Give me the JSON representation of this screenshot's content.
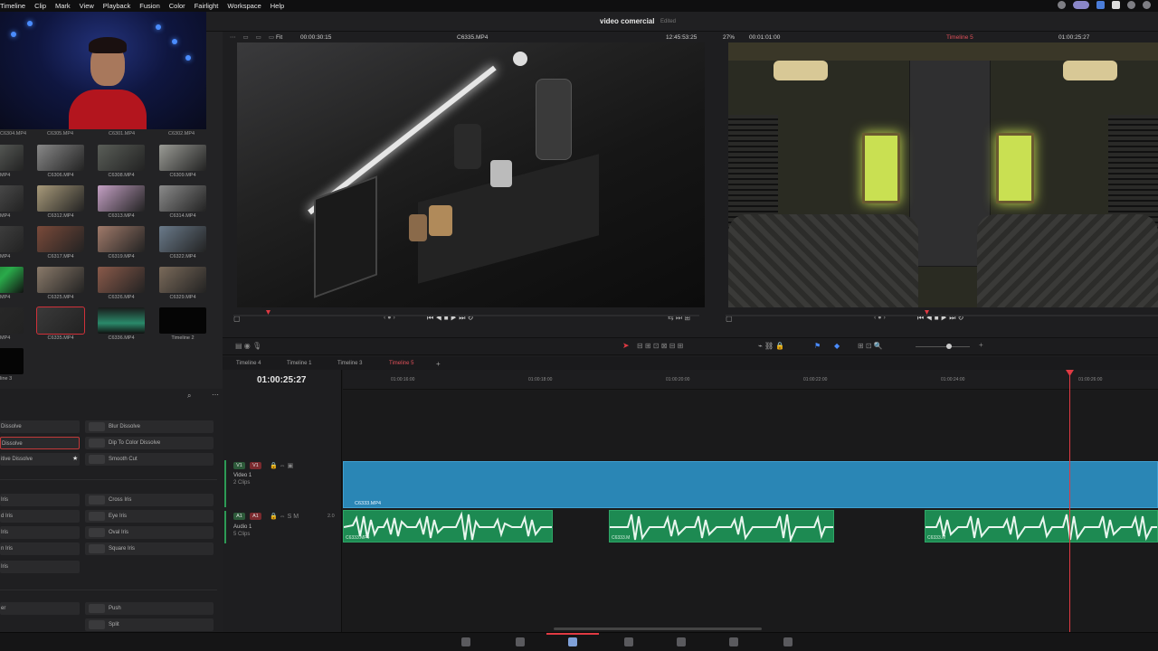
{
  "menu": {
    "items": [
      "Timeline",
      "Clip",
      "Mark",
      "View",
      "Playback",
      "Fusion",
      "Color",
      "Fairlight",
      "Workspace",
      "Help"
    ]
  },
  "project": {
    "title": "video comercial",
    "status": "Edited"
  },
  "media_pool": {
    "top_labels": [
      "C6304.MP4",
      "C6305.MP4",
      "C6301.MP4",
      "C6302.MP4"
    ],
    "rows": [
      {
        "labels": [
          "",
          "C6306.MP4",
          "C6308.MP4",
          "C6309.MP4"
        ],
        "left": "MP4"
      },
      {
        "labels": [
          "",
          "C6312.MP4",
          "C6313.MP4",
          "C6314.MP4"
        ],
        "left": "MP4"
      },
      {
        "labels": [
          "",
          "C6317.MP4",
          "C6319.MP4",
          "C6322.MP4"
        ],
        "left": "MP4"
      },
      {
        "labels": [
          "",
          "C6325.MP4",
          "C6326.MP4",
          "C6329.MP4"
        ],
        "left": "MP4"
      },
      {
        "labels": [
          "",
          "C6335.MP4",
          "C6336.MP4",
          "Timeline 2"
        ],
        "left": "MP4"
      }
    ],
    "last_label": "line 3",
    "selected": "C6335.MP4"
  },
  "effects": {
    "rows": [
      {
        "left": "Dissolve",
        "right": "Blur Dissolve"
      },
      {
        "left": "Dissolve",
        "right": "Dip To Color Dissolve",
        "selected": true
      },
      {
        "left": "itive Dissolve",
        "right": "Smooth Cut"
      },
      {
        "left": "Iris",
        "right": "Cross Iris"
      },
      {
        "left": "d Iris",
        "right": "Eye Iris"
      },
      {
        "left": "Iris",
        "right": "Oval Iris"
      },
      {
        "left": "n Iris",
        "right": "Square Iris"
      },
      {
        "left": "Iris",
        "right": ""
      },
      {
        "left": "er",
        "right": "Push"
      },
      {
        "left": "",
        "right": "Split"
      }
    ]
  },
  "source_viewer": {
    "zoom": "Fit",
    "timecode": "00:00:30:15",
    "clip": "C6335.MP4",
    "duration": "12:45:53:25"
  },
  "record_viewer": {
    "zoom": "27%",
    "timecode": "00:01:01:00",
    "timeline": "Timeline 5",
    "current": "01:00:25:27"
  },
  "timeline": {
    "tabs": [
      "Timeline 4",
      "Timeline 1",
      "Timeline 3",
      "Timeline 5"
    ],
    "active_tab": "Timeline 5",
    "add_tab": "+",
    "current_timecode": "01:00:25:27",
    "ruler": [
      "01:00:16:00",
      "01:00:18:00",
      "01:00:20:00",
      "01:00:22:00",
      "01:00:24:00",
      "01:00:26:00"
    ],
    "video_track": {
      "badge1": "V1",
      "badge2": "V1",
      "name": "Video 1",
      "clips": "2 Clips",
      "clip_name": "C6333.MP4"
    },
    "audio_track": {
      "badge1": "A1",
      "badge2": "A1",
      "name": "Audio 1",
      "clips": "5 Clips",
      "level": "2.0",
      "clip_names": [
        "C6333.MP4",
        "C6333.M",
        "C6333.M"
      ]
    }
  },
  "colors": {
    "accent_red": "#d0313a",
    "video_clip": "#2a86b5",
    "audio_clip": "#1d8a52",
    "playhead": "#e03a43"
  }
}
